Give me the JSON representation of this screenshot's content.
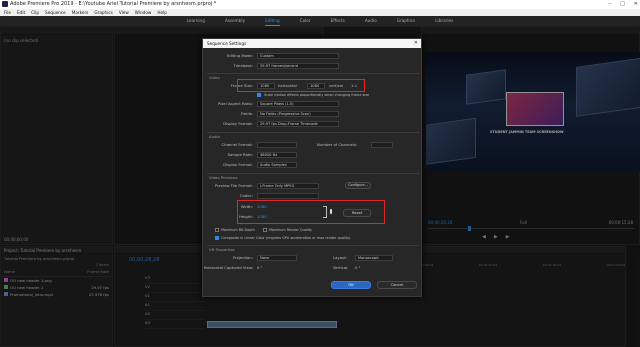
{
  "window": {
    "title": "Adobe Premiere Pro 2019 - E:\\Youtube Ariel Tutorial Premiere by arsnhesm.prproj *",
    "controls": [
      "–",
      "□",
      "✕"
    ]
  },
  "menu": [
    "File",
    "Edit",
    "Clip",
    "Sequence",
    "Markers",
    "Graphics",
    "View",
    "Window",
    "Help"
  ],
  "workspaces": {
    "items": [
      "Learning",
      "Assembly",
      "Editing",
      "Color",
      "Effects",
      "Audio",
      "Graphics",
      "Libraries"
    ],
    "active_index": 2
  },
  "source_panel": {
    "selection": "(no clip selected)",
    "timecode": "00;00;00;00"
  },
  "project_panel": {
    "title": "Project: Tutorial Premiere by arsnhesm",
    "file": "Tutorial Premiere by arsnhesm.prproj",
    "items_count": "3 Items",
    "col_name": "Name",
    "col_rate": "Frame Rate",
    "items": [
      {
        "name": "OO new header 1.png",
        "rate": ""
      },
      {
        "name": "OO new header 1",
        "rate": "29.97 fps"
      },
      {
        "name": "Promotional_Intro.mp4",
        "rate": "23.976 fps"
      }
    ]
  },
  "timeline": {
    "timecode": "00;00;28;28",
    "tracks": [
      "V3",
      "V2",
      "V1",
      "A1",
      "A2",
      "A3"
    ],
    "ruler": [
      "00;00",
      "00;00;16;00",
      "00;00;32;00",
      "00;00;48;00",
      "00;01;04;02",
      "00;01;20;02",
      "00;01;36;02",
      "00;01;52;02"
    ]
  },
  "program_panel": {
    "timecode": "00;00;28;28",
    "duration": "00;00;15;28",
    "fit": "Full",
    "overlay_text": "STUDENT JAMMIN TEAM SCREENSHOW"
  },
  "dialog": {
    "title": "Sequence Settings",
    "close": "✕",
    "editing_mode": {
      "label": "Editing Mode:",
      "value": "Custom"
    },
    "timebase": {
      "label": "Timebase:",
      "value": "29.97 frames/second"
    },
    "video_section": "Video",
    "frame_size": {
      "label": "Frame Size:",
      "h": "1080",
      "h_label": "horizontal",
      "v": "1080",
      "v_label": "vertical",
      "ratio": "1:1"
    },
    "scale_note": "Scale motion effects proportionally when changing frame size",
    "pixel_aspect": {
      "label": "Pixel Aspect Ratio:",
      "value": "Square Pixels (1.0)"
    },
    "fields": {
      "label": "Fields:",
      "value": "No Fields (Progressive Scan)"
    },
    "display_format": {
      "label": "Display Format:",
      "value": "29.97 fps Drop-Frame Timecode"
    },
    "audio_section": "Audio",
    "channel_format": {
      "label": "Channel Format:",
      "value": "",
      "channels_label": "Number of Channels:"
    },
    "sample_rate": {
      "label": "Sample Rate:",
      "value": "48000 Hz"
    },
    "audio_display_format": {
      "label": "Display Format:",
      "value": "Audio Samples"
    },
    "video_previews_section": "Video Previews",
    "preview_file_format": {
      "label": "Preview File Format:",
      "value": "I-Frame Only MPEG",
      "configure": "Configure..."
    },
    "codec": {
      "label": "Codec:",
      "value": ""
    },
    "width": {
      "label": "Width:",
      "value": "1080"
    },
    "height": {
      "label": "Height:",
      "value": "1080"
    },
    "reset": "Reset",
    "max_bit_depth": "Maximum Bit Depth",
    "max_render_quality": "Maximum Render Quality",
    "composite_linear": "Composite in Linear Color (requires GPU acceleration or max render quality)",
    "vr_section": "VR Properties",
    "projection": {
      "label": "Projection:",
      "value": "None",
      "layout_label": "Layout:",
      "layout_value": "Monoscopic"
    },
    "captured_view": {
      "label": "Horizontal Captured View:",
      "value": "0 °",
      "vertical_label": "Vertical:",
      "vertical_value": "0 °"
    },
    "ok": "OK",
    "cancel": "Cancel"
  },
  "colors": {
    "accent": "#2d8ceb",
    "highlight_box": "#e0252b",
    "ok_button": "#2a67c2"
  }
}
